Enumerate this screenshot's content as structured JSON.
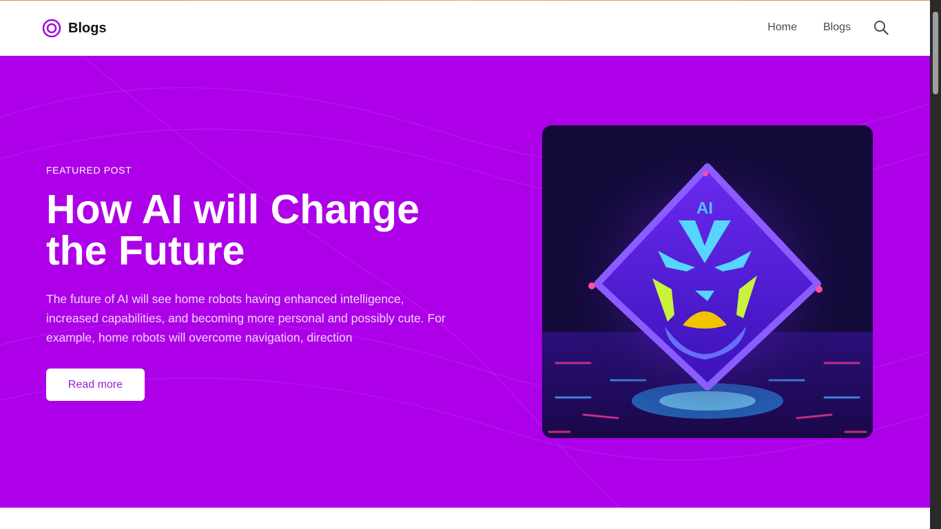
{
  "brand": {
    "name": "Blogs",
    "logo_icon": "target-ring-icon",
    "accent_color": "#a40ad6"
  },
  "nav": {
    "links": [
      {
        "label": "Home"
      },
      {
        "label": "Blogs"
      }
    ],
    "search_icon": "search-icon"
  },
  "hero": {
    "background_color": "#ad00e8",
    "eyebrow": "FEATURED POST",
    "title": "How AI will Change the Future",
    "description": "The future of AI will see home robots having enhanced intelligence, increased capabilities, and becoming more personal and possibly cute. For example, home robots will overcome navigation, direction",
    "cta_label": "Read more",
    "image_text": "AI"
  }
}
